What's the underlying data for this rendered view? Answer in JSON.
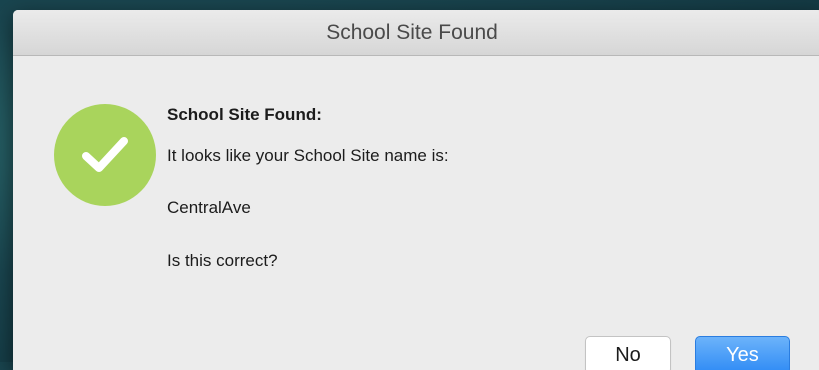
{
  "window": {
    "title": "School Site Found"
  },
  "message": {
    "heading": "School Site Found:",
    "line1": "It looks like your School Site name is:",
    "site_name": "CentralAve",
    "question": "Is this correct?"
  },
  "icon": {
    "name": "checkmark-icon",
    "badge_color": "#a9d45c"
  },
  "buttons": {
    "no_label": "No",
    "yes_label": "Yes",
    "primary_color": "#2f8bf5"
  }
}
